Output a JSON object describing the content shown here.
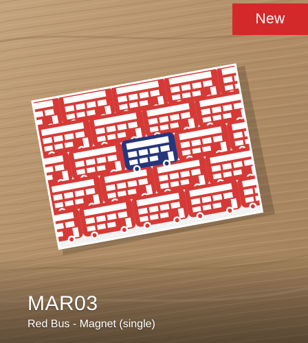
{
  "product": {
    "badge": "New",
    "sku": "MAR03",
    "name": "Red Bus - Magnet (single)"
  },
  "photo": {
    "subject": "red-bus-magnet-photo",
    "colors": {
      "wood": "#b5946d",
      "magnet_red": "#d63a36",
      "magnet_navy": "#27367a",
      "magnet_white": "#ffffff"
    }
  },
  "colors": {
    "badge_bg": "#d3292a",
    "text": "#ffffff"
  }
}
